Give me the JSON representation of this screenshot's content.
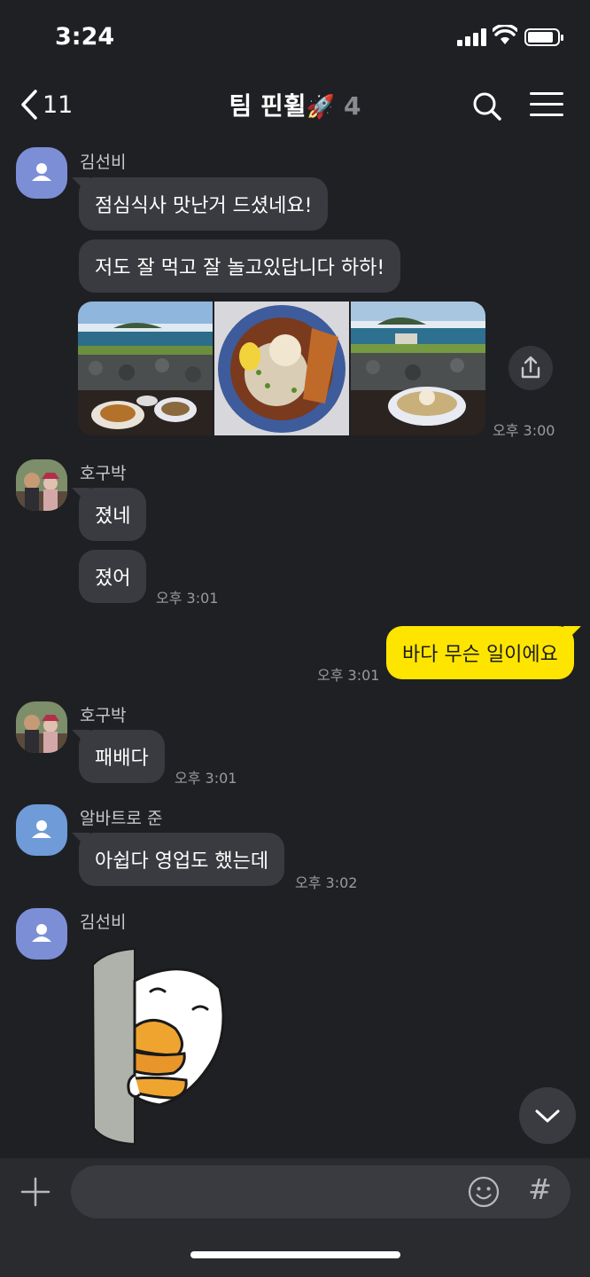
{
  "status_bar": {
    "time": "3:24"
  },
  "header": {
    "back_count": "11",
    "title": "팀 핀휠",
    "title_emoji": "🚀",
    "member_count": "4"
  },
  "messages": {
    "m1": {
      "sender": "김선비",
      "bubble1": "점심식사 맛난거 드셨네요!",
      "bubble2": "저도 잘 먹고 잘 놀고있답니다 하하!",
      "time": "오후 3:00"
    },
    "m2": {
      "sender": "호구박",
      "bubble1": "졌네",
      "bubble2": "졌어",
      "time": "오후 3:01"
    },
    "m3": {
      "text": "바다 무슨 일이에요",
      "time": "오후 3:01"
    },
    "m4": {
      "sender": "호구박",
      "bubble1": "패배다",
      "time": "오후 3:01"
    },
    "m5": {
      "sender": "알바트로 준",
      "bubble1": "아쉽다 영업도 했는데",
      "time": "오후 3:02"
    },
    "m6": {
      "sender": "김선비"
    }
  },
  "input": {
    "placeholder": ""
  },
  "colors": {
    "background": "#1f2024",
    "bubble": "#3a3b40",
    "my_bubble": "#fee500",
    "input_bar": "#2a2b2f"
  }
}
